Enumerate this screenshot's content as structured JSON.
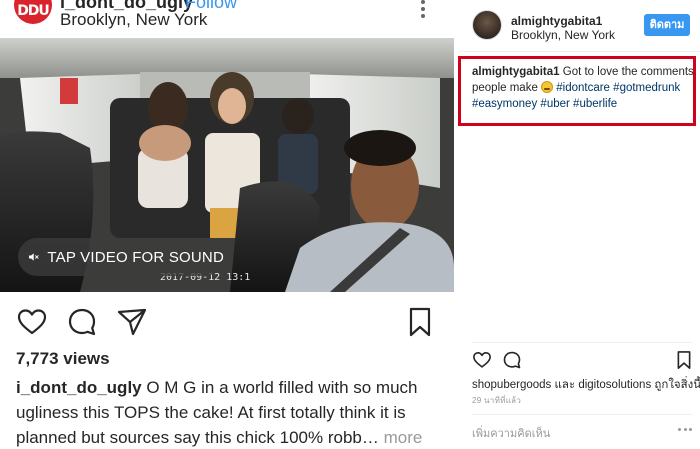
{
  "left_post": {
    "avatar_text": "DDU",
    "username": "i_dont_do_ugly",
    "follow_label": "Follow",
    "location": "Brooklyn, New York",
    "video": {
      "sound_label": "TAP VIDEO FOR SOUND",
      "timestamp": "2017-09-12 13:1"
    },
    "views": "7,773 views",
    "caption": {
      "user": "i_dont_do_ugly",
      "text": " O M G in a world filled with so much ugliness this TOPS the cake!  At first totally think it is planned but sources say this chick 100% robb…",
      "more": " more"
    }
  },
  "right_post": {
    "username": "almightygabita1",
    "location": "Brooklyn, New York",
    "follow_label": "ติดตาม",
    "comment": {
      "user": "almightygabita1",
      "text": " Got to love the comments people make ",
      "tags": [
        "#idontcare",
        "#gotmedrunk",
        "#easymoney",
        "#uber",
        "#uberlife"
      ]
    },
    "likes": "shopubergoods และ digitosolutions ถูกใจสิ่งนี้",
    "time": "29 นาทีที่แล้ว",
    "add_comment_placeholder": "เพิ่มความคิดเห็น"
  },
  "colors": {
    "link_blue": "#3897f0",
    "highlight_red": "#d0021b",
    "hashtag_blue": "#003569",
    "avatar_red": "#d9232d"
  },
  "icons": [
    "heart-icon",
    "comment-icon",
    "share-icon",
    "bookmark-icon",
    "speaker-muted-icon",
    "more-options-icon"
  ]
}
